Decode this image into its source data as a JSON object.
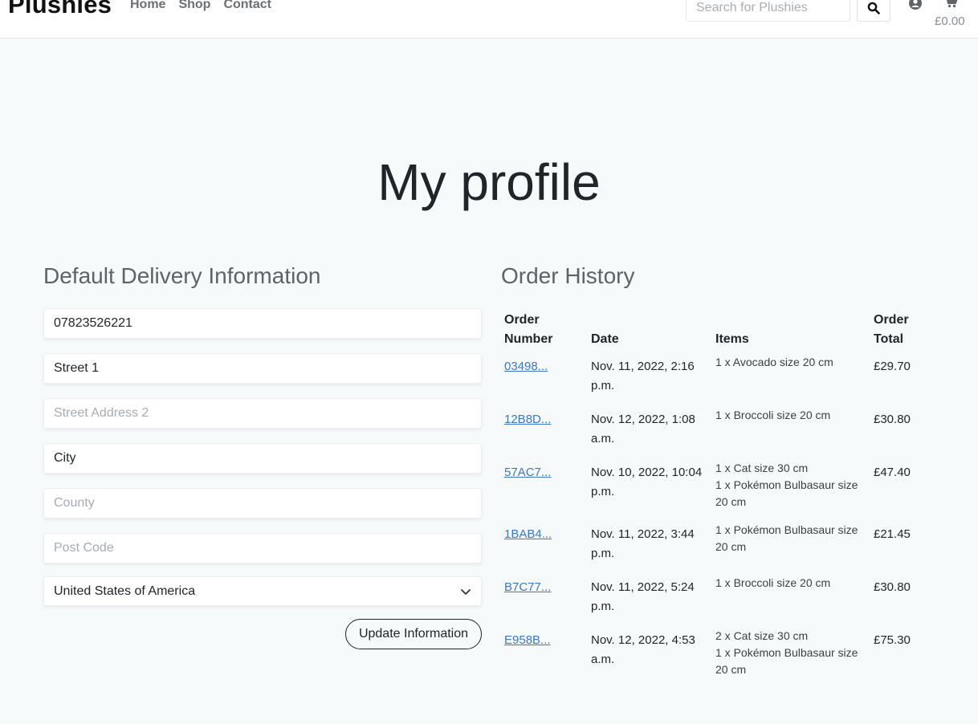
{
  "header": {
    "brand": "Plushies",
    "nav": [
      "Home",
      "Shop",
      "Contact"
    ],
    "search_placeholder": "Search for Plushies",
    "cart_total": "£0.00"
  },
  "page_title": "My profile",
  "delivery": {
    "heading": "Default Delivery Information",
    "phone": "07823526221",
    "street1": "Street 1",
    "street2_placeholder": "Street Address 2",
    "city": "City",
    "county_placeholder": "County",
    "postcode_placeholder": "Post Code",
    "country": "United States of America",
    "update_label": "Update Information"
  },
  "orders": {
    "heading": "Order History",
    "columns": [
      "Order Number",
      "Date",
      "Items",
      "Order Total"
    ],
    "rows": [
      {
        "number": "03498...",
        "date": "Nov. 11, 2022, 2:16 p.m.",
        "items": [
          "1 x Avocado size 20 cm"
        ],
        "total": "£29.70"
      },
      {
        "number": "12B8D...",
        "date": "Nov. 12, 2022, 1:08 a.m.",
        "items": [
          "1 x Broccoli size 20 cm"
        ],
        "total": "£30.80"
      },
      {
        "number": "57AC7...",
        "date": "Nov. 10, 2022, 10:04 p.m.",
        "items": [
          "1 x Cat size 30 cm",
          "1 x Pokémon Bulbasaur size 20 cm"
        ],
        "total": "£47.40"
      },
      {
        "number": "1BAB4...",
        "date": "Nov. 11, 2022, 3:44 p.m.",
        "items": [
          "1 x Pokémon Bulbasaur size 20 cm"
        ],
        "total": "£21.45"
      },
      {
        "number": "B7C77...",
        "date": "Nov. 11, 2022, 5:24 p.m.",
        "items": [
          "1 x Broccoli size 20 cm"
        ],
        "total": "£30.80"
      },
      {
        "number": "E958B...",
        "date": "Nov. 12, 2022, 4:53 a.m.",
        "items": [
          "2 x Cat size 30 cm",
          "1 x Pokémon Bulbasaur size 20 cm"
        ],
        "total": "£75.30"
      }
    ]
  }
}
